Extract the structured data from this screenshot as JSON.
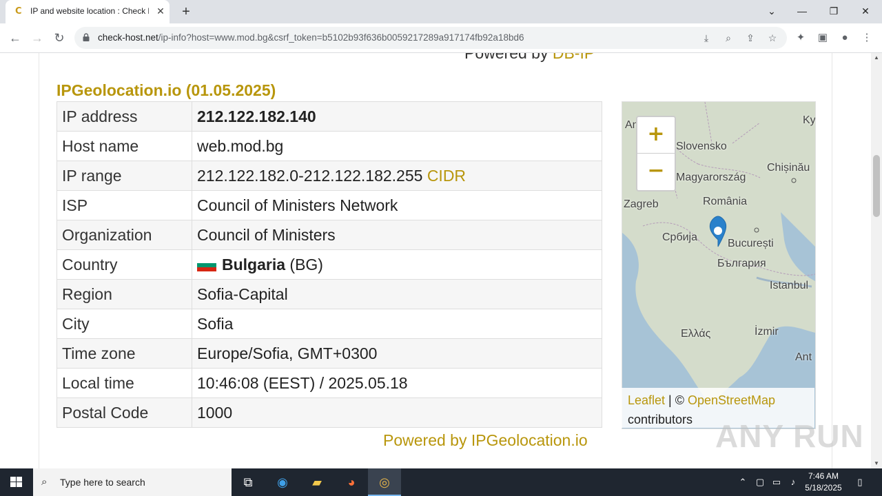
{
  "browser": {
    "tab_title": "IP and website location : Check host - online website monitoring",
    "url_host": "check-host.net",
    "url_path": "/ip-info?host=www.mod.bg&csrf_token=b5102b93f636b0059217289a917174fb92a18bd6"
  },
  "page": {
    "top_powered_prefix": "Powered by ",
    "top_powered_link": "DB-IP",
    "section_title": "IPGeolocation.io (01.05.2025)",
    "rows": [
      {
        "label": "IP address",
        "value": "212.122.182.140"
      },
      {
        "label": "Host name",
        "value": "web.mod.bg"
      },
      {
        "label": "IP range",
        "value": "212.122.182.0-212.122.182.255",
        "link": "CIDR"
      },
      {
        "label": "ISP",
        "value": "Council of Ministers Network"
      },
      {
        "label": "Organization",
        "value": "Council of Ministers"
      },
      {
        "label": "Country",
        "value": "Bulgaria",
        "code": "(BG)"
      },
      {
        "label": "Region",
        "value": "Sofia-Capital"
      },
      {
        "label": "City",
        "value": "Sofia"
      },
      {
        "label": "Time zone",
        "value": "Europe/Sofia, GMT+0300"
      },
      {
        "label": "Local time",
        "value": "10:46:08 (EEST) / 2025.05.18"
      },
      {
        "label": "Postal Code",
        "value": "1000"
      }
    ],
    "bottom_powered_prefix": "Powered by ",
    "bottom_powered_link": "IPGeolocation.io"
  },
  "map": {
    "zoom_in": "+",
    "zoom_out": "−",
    "labels": [
      "Zagreb",
      "România",
      "Chișinău",
      "Србија",
      "București",
      "България",
      "Istanbul",
      "Ελλάς",
      "İzmir",
      "Magyarország",
      "Slovensko",
      "Kyiv",
      "Ant"
    ],
    "attribution_leaflet": "Leaflet",
    "attribution_sep": " | © ",
    "attribution_osm": "OpenStreetMap",
    "attribution_tail": "contributors",
    "water_color": "#a7c3d6",
    "land_color": "#d4dccb",
    "marker_color": "#2a81cb"
  },
  "taskbar": {
    "search_placeholder": "Type here to search",
    "time": "7:46 AM",
    "date": "5/18/2025"
  },
  "watermark": "ANY RUN",
  "colors": {
    "accent_gold": "#b8960c",
    "taskbar": "#1f2630"
  }
}
